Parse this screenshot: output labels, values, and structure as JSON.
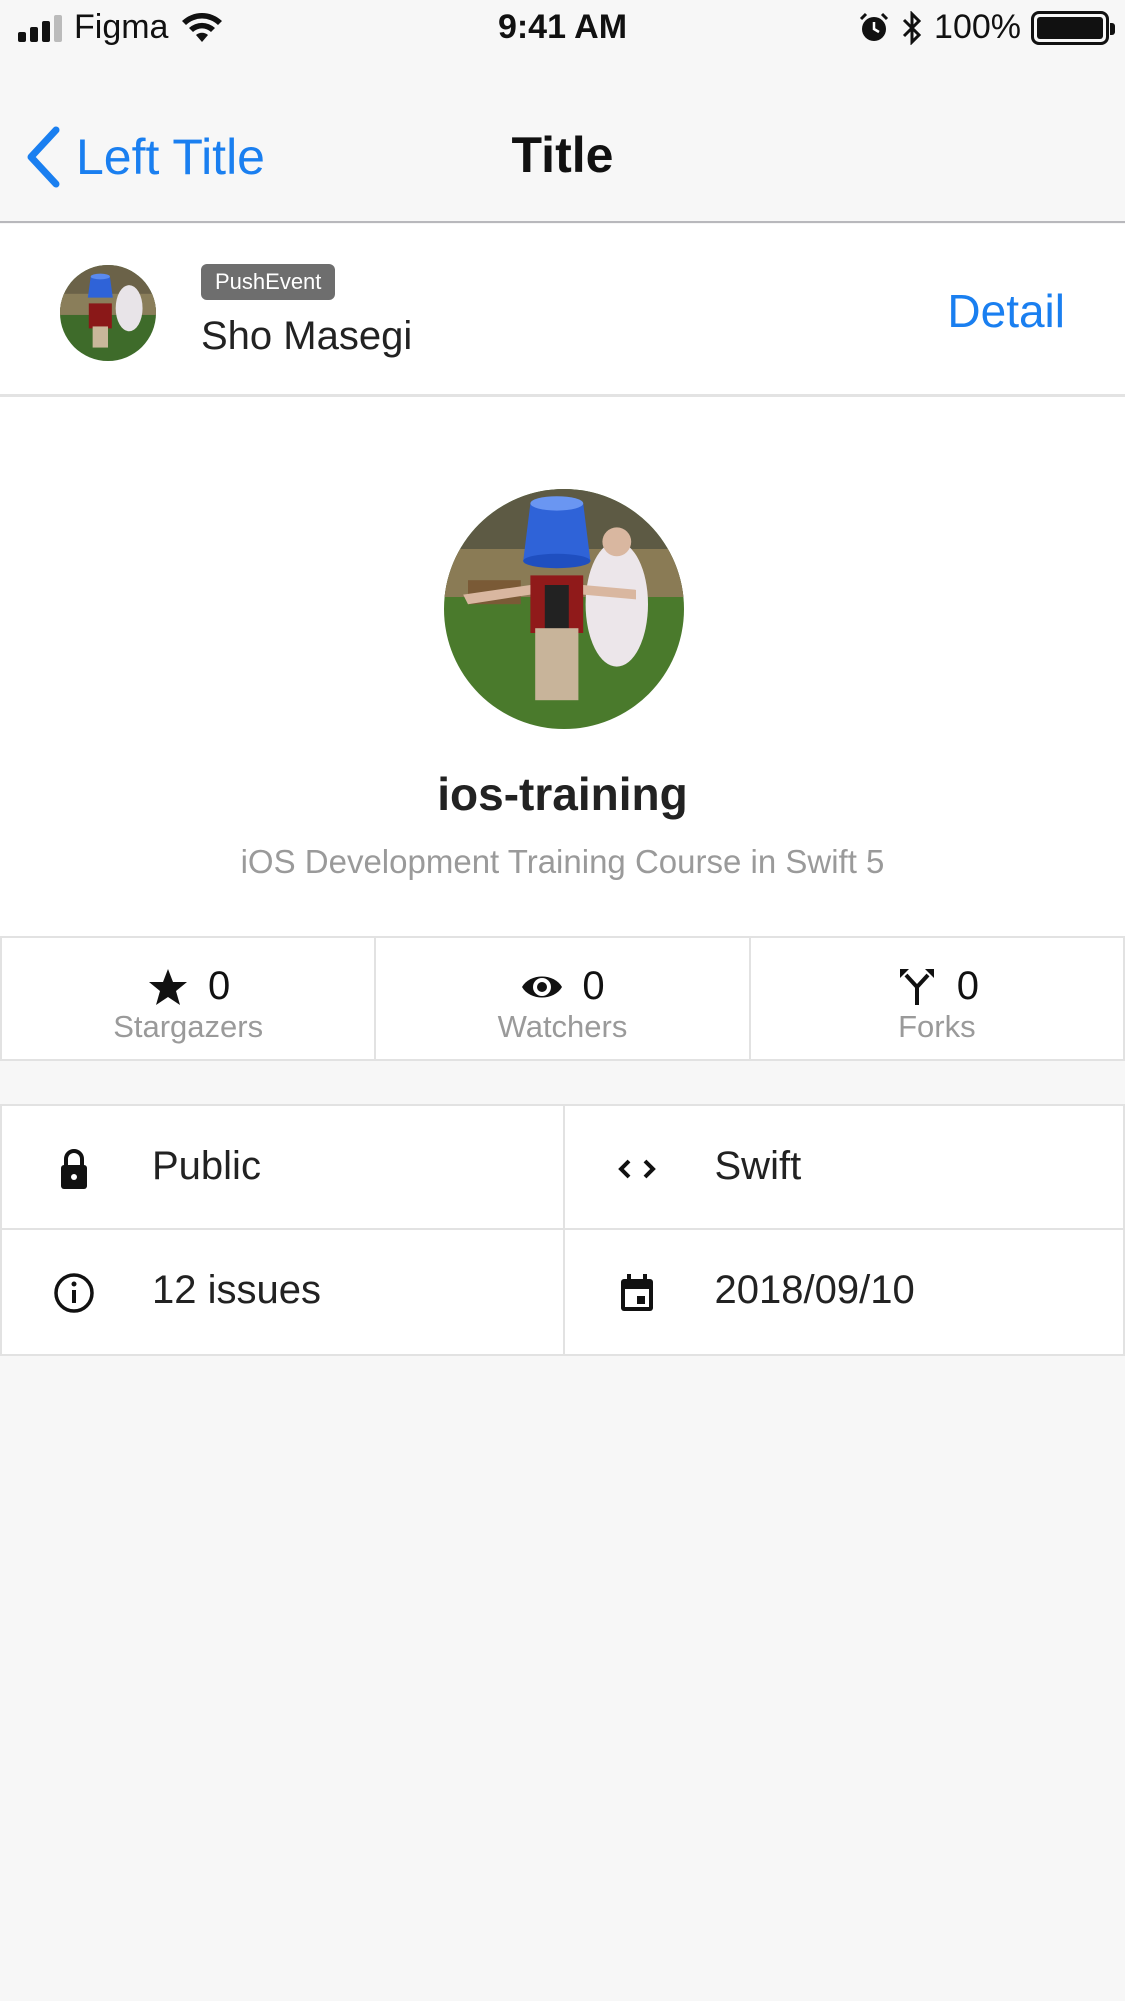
{
  "status_bar": {
    "carrier": "Figma",
    "time": "9:41 AM",
    "battery": "100%"
  },
  "nav": {
    "back_label": "Left Title",
    "title": "Title"
  },
  "event": {
    "badge": "PushEvent",
    "user": "Sho Masegi",
    "detail_label": "Detail"
  },
  "repo": {
    "name": "ios-training",
    "description": "iOS Development Training Course in Swift 5"
  },
  "stats": [
    {
      "icon": "star-icon",
      "value": "0",
      "label": "Stargazers"
    },
    {
      "icon": "eye-icon",
      "value": "0",
      "label": "Watchers"
    },
    {
      "icon": "fork-icon",
      "value": "0",
      "label": "Forks"
    }
  ],
  "info": [
    {
      "icon": "lock-icon",
      "text": "Public"
    },
    {
      "icon": "code-icon",
      "text": "Swift"
    },
    {
      "icon": "info-icon",
      "text": "12 issues"
    },
    {
      "icon": "calendar-icon",
      "text": "2018/09/10"
    }
  ],
  "colors": {
    "accent": "#1a7ff0",
    "background": "#f7f7f7",
    "badge": "#6e6e6e",
    "secondary_text": "#9a9a9a"
  }
}
